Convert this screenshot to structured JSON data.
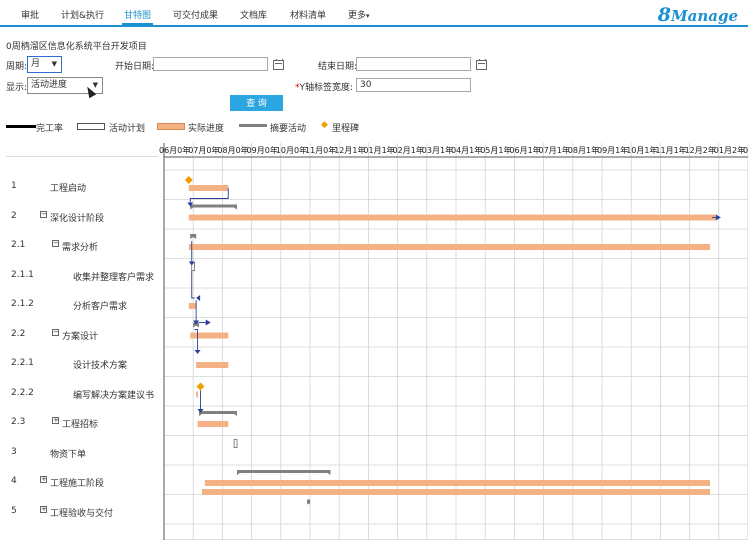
{
  "nav": {
    "tabs": [
      "审批",
      "计划&执行",
      "甘特图",
      "可交付成果",
      "文档库",
      "材料清单",
      "更多"
    ],
    "active": 2,
    "more_arrow": "▾",
    "logo_prefix": "8",
    "logo_text": "Manage"
  },
  "project_title": "0周柄溜区信息化系统平台开发项目",
  "filters": {
    "period_label": "周期:",
    "period_value": "月",
    "start_label": "开始日期:",
    "start_value": "",
    "end_label": "结束日期:",
    "end_value": "",
    "display_label": "显示:",
    "display_value": "活动进度",
    "ywidth_label": "Y轴标签宽度:",
    "ywidth_value": "30",
    "query_label": "查 询"
  },
  "legend": {
    "complete": "完工率",
    "plan": "活动计划",
    "actual": "实际进度",
    "summary": "摘要活动",
    "milestone": "里程碑",
    "diamond_glyph": "◆"
  },
  "colors": {
    "accent": "#1a90d0",
    "actual_bar": "#f4b183",
    "summary_bar": "#808080",
    "milestone": "#f0a000",
    "link": "#2a3f9a",
    "grid": "#d4d4d4"
  },
  "timeline": {
    "months": [
      "06月",
      "07月",
      "08月",
      "09月",
      "10月",
      "11月",
      "12月",
      "01月",
      "02月",
      "03月",
      "04月",
      "05月",
      "06月",
      "07月",
      "08月",
      "09月",
      "10月",
      "11月",
      "12月",
      "01月",
      "02月"
    ],
    "years": [
      "0年",
      "0年",
      "0年",
      "0年",
      "0年",
      "0年",
      "1年",
      "1年",
      "1年",
      "1年",
      "1年",
      "1年",
      "1年",
      "1年",
      "1年",
      "1年",
      "1年",
      "1年",
      "2年",
      "2年",
      ""
    ]
  },
  "tasks": [
    {
      "num": "1",
      "name": "工程启动",
      "level": 1,
      "toggle": ""
    },
    {
      "num": "2",
      "name": "深化设计阶段",
      "level": 1,
      "toggle": "⊟"
    },
    {
      "num": "2.1",
      "name": "需求分析",
      "level": 2,
      "toggle": "⊟"
    },
    {
      "num": "2.1.1",
      "name": "收集并整理客户需求",
      "level": 3,
      "toggle": ""
    },
    {
      "num": "2.1.2",
      "name": "分析客户需求",
      "level": 3,
      "toggle": ""
    },
    {
      "num": "2.2",
      "name": "方案设计",
      "level": 2,
      "toggle": "⊟"
    },
    {
      "num": "2.2.1",
      "name": "设计技术方案",
      "level": 3,
      "toggle": ""
    },
    {
      "num": "2.2.2",
      "name": "编写解决方案建议书",
      "level": 3,
      "toggle": ""
    },
    {
      "num": "2.3",
      "name": "工程招标",
      "level": 2,
      "toggle": "⊞"
    },
    {
      "num": "3",
      "name": "物资下单",
      "level": 1,
      "toggle": ""
    },
    {
      "num": "4",
      "name": "工程施工阶段",
      "level": 1,
      "toggle": "⊞"
    },
    {
      "num": "5",
      "name": "工程验收与交付",
      "level": 1,
      "toggle": "⊞"
    }
  ],
  "bars": {
    "actual": [
      {
        "row": 0,
        "start": 0.85,
        "end": 2.2
      },
      {
        "row": 1,
        "start": 0.85,
        "end": 18.9
      },
      {
        "row": 2,
        "start": 0.85,
        "end": 18.7
      },
      {
        "row": 4,
        "start": 0.85,
        "end": 1.1
      },
      {
        "row": 5,
        "start": 0.9,
        "end": 2.2
      },
      {
        "row": 6,
        "start": 1.1,
        "end": 2.2
      },
      {
        "row": 7,
        "start": 1.1,
        "end": 1.15
      },
      {
        "row": 8,
        "start": 1.15,
        "end": 2.2
      },
      {
        "row": 10,
        "start": 1.4,
        "end": 18.7
      }
    ],
    "actual_lower": [
      {
        "row": 10,
        "start": 1.3,
        "end": 18.7
      }
    ],
    "summary": [
      {
        "row": 1,
        "start": 0.9,
        "end": 2.5
      },
      {
        "row": 2,
        "start": 0.9,
        "end": 1.1
      },
      {
        "row": 5,
        "start": 1.0,
        "end": 1.2
      },
      {
        "row": 8,
        "start": 1.2,
        "end": 2.5
      },
      {
        "row": 10,
        "start": 2.5,
        "end": 5.7
      },
      {
        "row": 11,
        "start": 4.9,
        "end": 5.0
      }
    ],
    "plan": [
      {
        "row": 3,
        "start": 0.95,
        "end": 1.05
      },
      {
        "row": 9,
        "start": 2.4,
        "end": 2.5
      }
    ],
    "milestones": [
      {
        "row": 0,
        "at": 0.85
      },
      {
        "row": 7,
        "at": 1.25
      }
    ]
  }
}
